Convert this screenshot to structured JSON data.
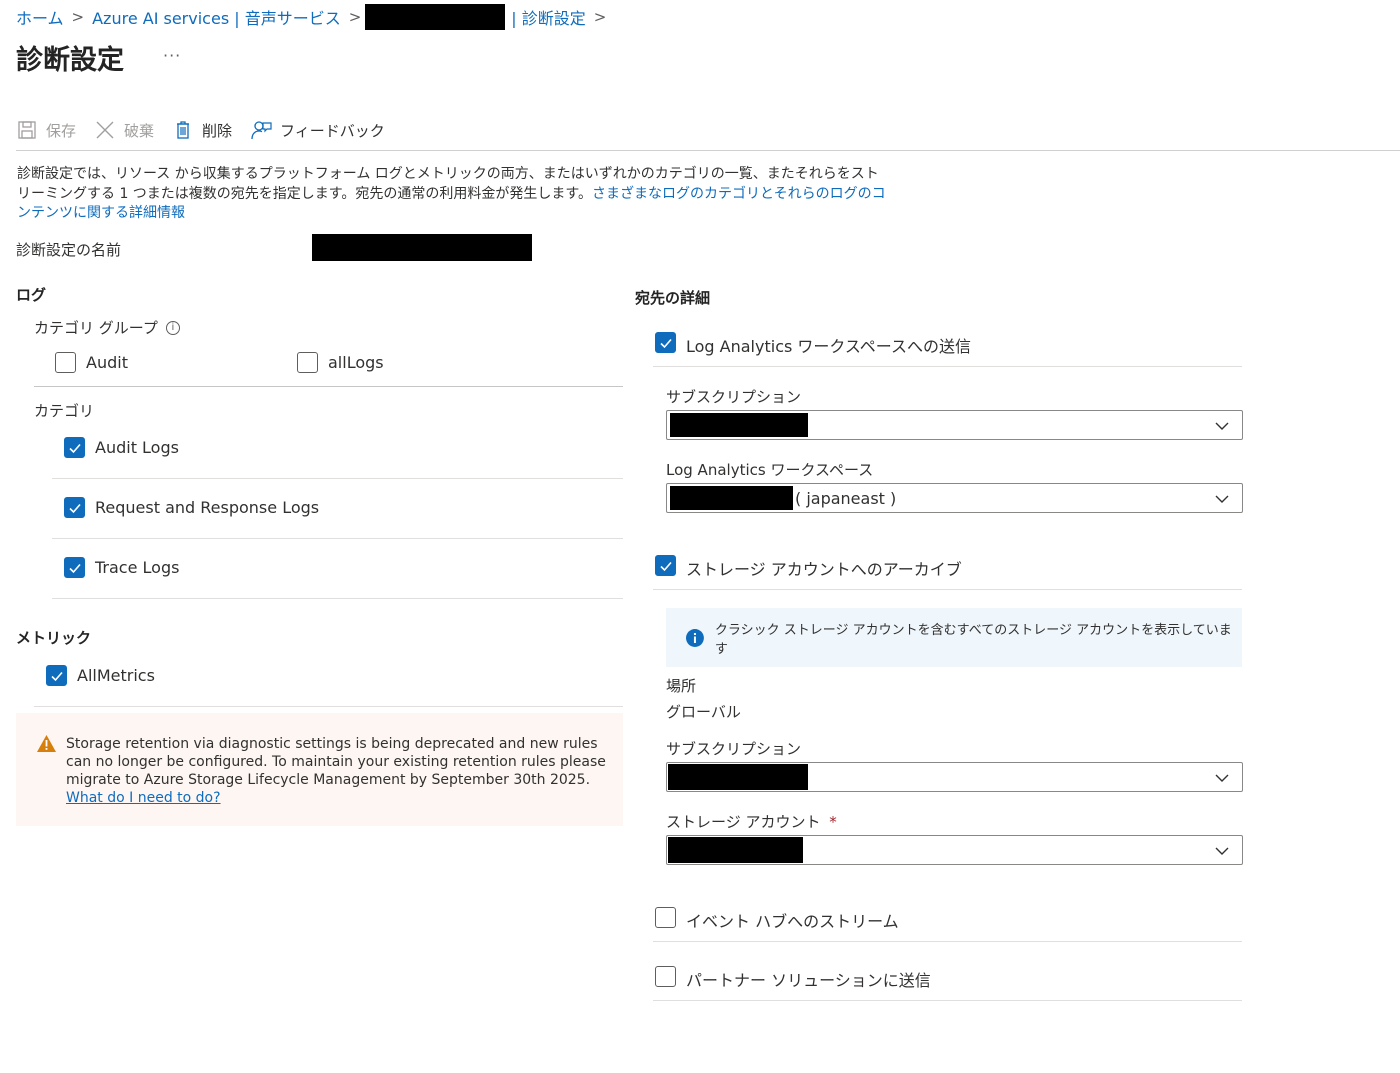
{
  "breadcrumb": {
    "home": "ホーム",
    "service": "Azure AI services | 音声サービス",
    "current": "| 診断設定"
  },
  "page_title": "診断設定",
  "more_label": "···",
  "toolbar": {
    "save": "保存",
    "discard": "破棄",
    "delete": "削除",
    "feedback": "フィードバック"
  },
  "description": {
    "text": "診断設定では、リソース から収集するプラットフォーム ログとメトリックの両方、またはいずれかのカテゴリの一覧、またそれらをストリーミングする 1 つまたは複数の宛先を指定します。宛先の通常の利用料金が発生します。",
    "link": "さまざまなログのカテゴリとそれらのログのコンテンツに関する詳細情報"
  },
  "setting_name_label": "診断設定の名前",
  "logs": {
    "heading": "ログ",
    "category_group_label": "カテゴリ グループ",
    "groups": [
      {
        "label": "Audit",
        "checked": false
      },
      {
        "label": "allLogs",
        "checked": false
      }
    ],
    "category_label": "カテゴリ",
    "categories": [
      {
        "label": "Audit Logs",
        "checked": true
      },
      {
        "label": "Request and Response Logs",
        "checked": true
      },
      {
        "label": "Trace Logs",
        "checked": true
      }
    ]
  },
  "metrics": {
    "heading": "メトリック",
    "items": [
      {
        "label": "AllMetrics",
        "checked": true
      }
    ]
  },
  "warning": {
    "text": "Storage retention via diagnostic settings is being deprecated and new rules can no longer be configured. To maintain your existing retention rules please migrate to Azure Storage Lifecycle Management by September 30th 2025.",
    "link": "What do I need to do?"
  },
  "destination": {
    "heading": "宛先の詳細",
    "log_analytics": {
      "label": "Log Analytics ワークスペースへの送信",
      "checked": true,
      "subscription_label": "サブスクリプション",
      "workspace_label": "Log Analytics ワークスペース",
      "workspace_region": "( japaneast )"
    },
    "storage": {
      "label": "ストレージ アカウントへのアーカイブ",
      "checked": true,
      "info": "クラシック ストレージ アカウントを含むすべてのストレージ アカウントを表示しています",
      "location_label": "場所",
      "location_value": "グローバル",
      "subscription_label": "サブスクリプション",
      "account_label": "ストレージ アカウント",
      "required_mark": "*"
    },
    "event_hub": {
      "label": "イベント ハブへのストリーム",
      "checked": false
    },
    "partner": {
      "label": "パートナー ソリューションに送信",
      "checked": false
    }
  },
  "colors": {
    "accent": "#0f6cbd",
    "warning_icon": "#d67f0b",
    "info_bg": "#eff6fc",
    "warning_bg": "#fdf6f3",
    "redaction": "#000000"
  }
}
